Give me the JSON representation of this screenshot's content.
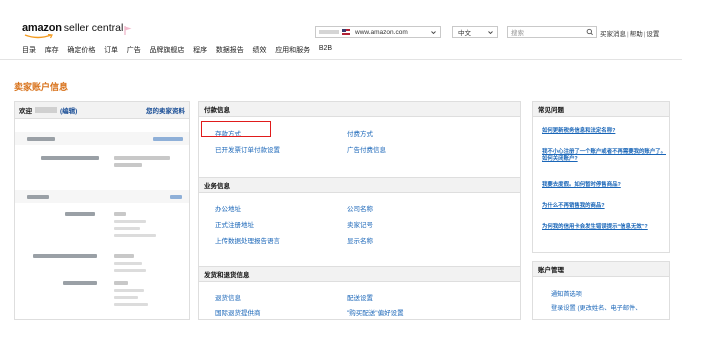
{
  "header": {
    "logo_brand": "amazon",
    "logo_sub": "seller central",
    "marketplace_url": "www.amazon.com",
    "language": "中文",
    "search_placeholder": "搜索",
    "top_links": [
      "买家消息",
      "帮助",
      "设置"
    ]
  },
  "nav": [
    "目录",
    "库存",
    "确定价格",
    "订单",
    "广告",
    "品牌旗舰店",
    "程序",
    "数据报告",
    "绩效",
    "应用和服务",
    "B2B"
  ],
  "page_title": "卖家账户信息",
  "account_panel": {
    "welcome": "欢迎",
    "edit": "(编辑)",
    "profile_link": "您的卖家资料"
  },
  "settings": {
    "payment": {
      "title": "付款信息",
      "links": [
        "存款方式",
        "付费方式",
        "已开发票订单付款设置",
        "广告付费信息"
      ]
    },
    "business": {
      "title": "业务信息",
      "links": [
        "办公地址",
        "公司名称",
        "正式注册地址",
        "卖家记号",
        "上传数据处理报告语言",
        "显示名称"
      ]
    },
    "shipping": {
      "title": "发货和退货信息",
      "links": [
        "退货信息",
        "配送设置",
        "国际退货提供商",
        "\"购买配送\"偏好设置"
      ]
    }
  },
  "faq": {
    "title": "常见问题",
    "questions": [
      "如何更新税务信息和法定名称?",
      "我不小心注册了一个账户或者不再需要我的账户了。如何关闭账户?",
      "我要去度假。如何暂时停售商品?",
      "为什么不再销售我的商品?",
      "为何我的信用卡会发生错误提示“信息无效”?"
    ]
  },
  "account_management": {
    "title": "账户管理",
    "links": [
      "通知首选项",
      "登录设置 (更改姓名、电子邮件、"
    ]
  },
  "colors": {
    "link": "#1a66b8",
    "title_orange": "#d8721b",
    "highlight_red": "#e01b1b",
    "panel_header_bg": "#f2f2f2"
  }
}
